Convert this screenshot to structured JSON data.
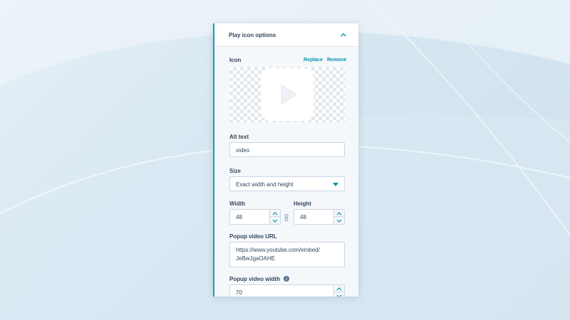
{
  "panel": {
    "title": "Play icon options",
    "icon_section": {
      "label": "Icon",
      "replace_label": "Replace",
      "remove_label": "Remove"
    },
    "alt_text": {
      "label": "Alt text",
      "value": "video"
    },
    "size": {
      "label": "Size",
      "selected": "Exact width and height"
    },
    "width": {
      "label": "Width",
      "value": "48"
    },
    "height": {
      "label": "Height",
      "value": "48"
    },
    "popup_url": {
      "label": "Popup video URL",
      "value": "https://www.youtube.com/embed/\nJeBwJgaOAHE"
    },
    "popup_width": {
      "label": "Popup video width",
      "value": "70"
    }
  },
  "colors": {
    "accent": "#0091ae",
    "panel_border": "#0f9eb7",
    "text": "#33475b"
  }
}
